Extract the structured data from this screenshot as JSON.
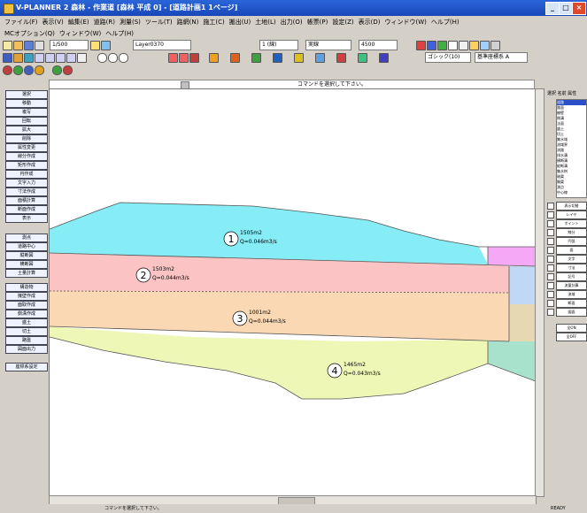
{
  "title": "V-PLANNER 2 森林 - 作業道 [森林 平成 0] - [道路計画1 1ページ]",
  "menu": [
    "ファイル(F)",
    "表示(V)",
    "編集(E)",
    "道路(R)",
    "測量(S)",
    "ツール(T)",
    "路網(N)",
    "施工(C)",
    "搬出(U)",
    "土地(L)",
    "出力(O)",
    "帳票(P)",
    "設定(Z)",
    "表示(D)",
    "ウィンドウ(W)",
    "ヘルプ(H)"
  ],
  "menu2": [
    "MCオプション(Q)",
    "ウィンドウ(W)",
    "ヘルプ(H)"
  ],
  "toolbar": {
    "combo_scale": "1/500",
    "combo_layer": "Layer0370",
    "combo_type": "1 (線)",
    "combo_style": "実線",
    "combo_width": "4500",
    "combo_font": "ゴシック(10)",
    "combo_font2": "基準座標系 A"
  },
  "command_prompt": "コマンドを選択して下さい。",
  "left_buttons": [
    "選択",
    "移動",
    "複写",
    "回転",
    "拡大",
    "削除",
    "属性変更",
    "線分作成",
    "矩形作成",
    "円作成",
    "文字入力",
    "寸法作成",
    "面積計算",
    "断面作成",
    "表示",
    "測点",
    "道路中心",
    "縦断図",
    "横断図",
    "土量計算",
    "構造物",
    "擁壁作成",
    "面取作成",
    "側溝作成",
    "盛土",
    "切土",
    "路盤",
    "図面出力",
    "座標系設定"
  ],
  "layers": [
    {
      "num": "1",
      "area": "1505m2",
      "flow": "Q=0.046m3/s",
      "color": "#86ecf5"
    },
    {
      "num": "2",
      "area": "1503m2",
      "flow": "Q=0.044m3/s",
      "color": "#fbc3c3"
    },
    {
      "num": "3",
      "area": "1001m2",
      "flow": "Q=0.044m3/s",
      "color": "#fbd8b4"
    },
    {
      "num": "4",
      "area": "1465m2",
      "flow": "Q=0.043m3/s",
      "color": "#eef7b6"
    }
  ],
  "side_colors": {
    "magenta": "#f5a8f5",
    "blue": "#c0d8f5",
    "tan": "#e6d8b0",
    "green": "#a8e2cc"
  },
  "right_panel": {
    "head": "選択 名前 属性",
    "list_items": [
      "道路",
      "路面",
      "擁壁",
      "側溝",
      "法面",
      "盛土",
      "切土",
      "集水域",
      "流域界",
      "流路",
      "排水溝",
      "横断溝",
      "縦断溝",
      "集水桝",
      "暗渠",
      "開渠",
      "測点",
      "中心線"
    ],
    "buttons": [
      "表示切替",
      "レイヤ",
      "ポイント",
      "線分",
      "円弧",
      "面",
      "文字",
      "寸法",
      "記号",
      "流量計算",
      "流域",
      "断面",
      "図面"
    ],
    "buttons2": [
      "全ON",
      "全OFF"
    ]
  },
  "status_left": "コマンドを選択して下さい。",
  "status_right": "READY"
}
